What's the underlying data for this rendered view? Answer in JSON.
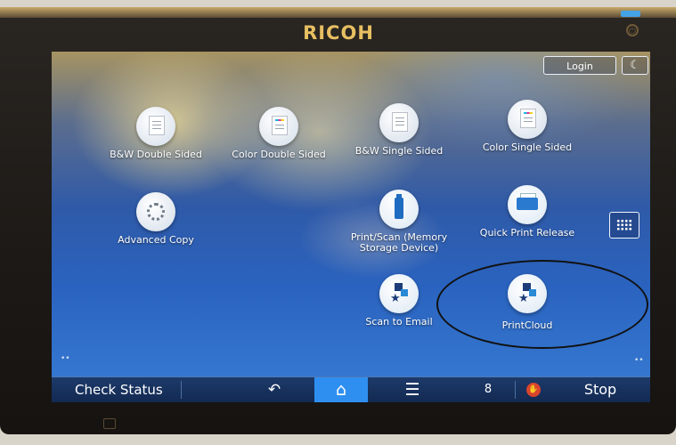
{
  "device": {
    "brand": "RICOH",
    "icons": {
      "power": "power-icon",
      "moon": "moon-icon",
      "bottom": "lock-icon"
    },
    "indicator_color": "#44a2e6",
    "brand_color": "#e7bf62"
  },
  "header": {
    "login_label": "Login",
    "energy_saver_glyph": "☾"
  },
  "apps": [
    {
      "label": "B&W Double Sided",
      "icon": "document-icon"
    },
    {
      "label": "Color Double Sided",
      "icon": "color-document-icon"
    },
    {
      "label": "B&W Single Sided",
      "icon": "document-icon"
    },
    {
      "label": "Color Single Sided",
      "icon": "color-document-icon"
    },
    {
      "label": "Advanced Copy",
      "icon": "gear-icon"
    },
    {
      "label": "Print/Scan (Memory Storage Device)",
      "icon": "usb-icon"
    },
    {
      "label": "Quick Print Release",
      "icon": "printer-icon"
    },
    {
      "label": "Scan to Email",
      "icon": "star-stack-icon"
    },
    {
      "label": "PrintCloud",
      "icon": "star-stack-icon"
    }
  ],
  "bottom_bar": {
    "check_status": "Check Status",
    "back_glyph": "↶",
    "home_glyph": "⌂",
    "menu_glyph": "☰",
    "small_glyph": "8",
    "stop_label": "Stop",
    "active_color": "#2f8ff0"
  }
}
